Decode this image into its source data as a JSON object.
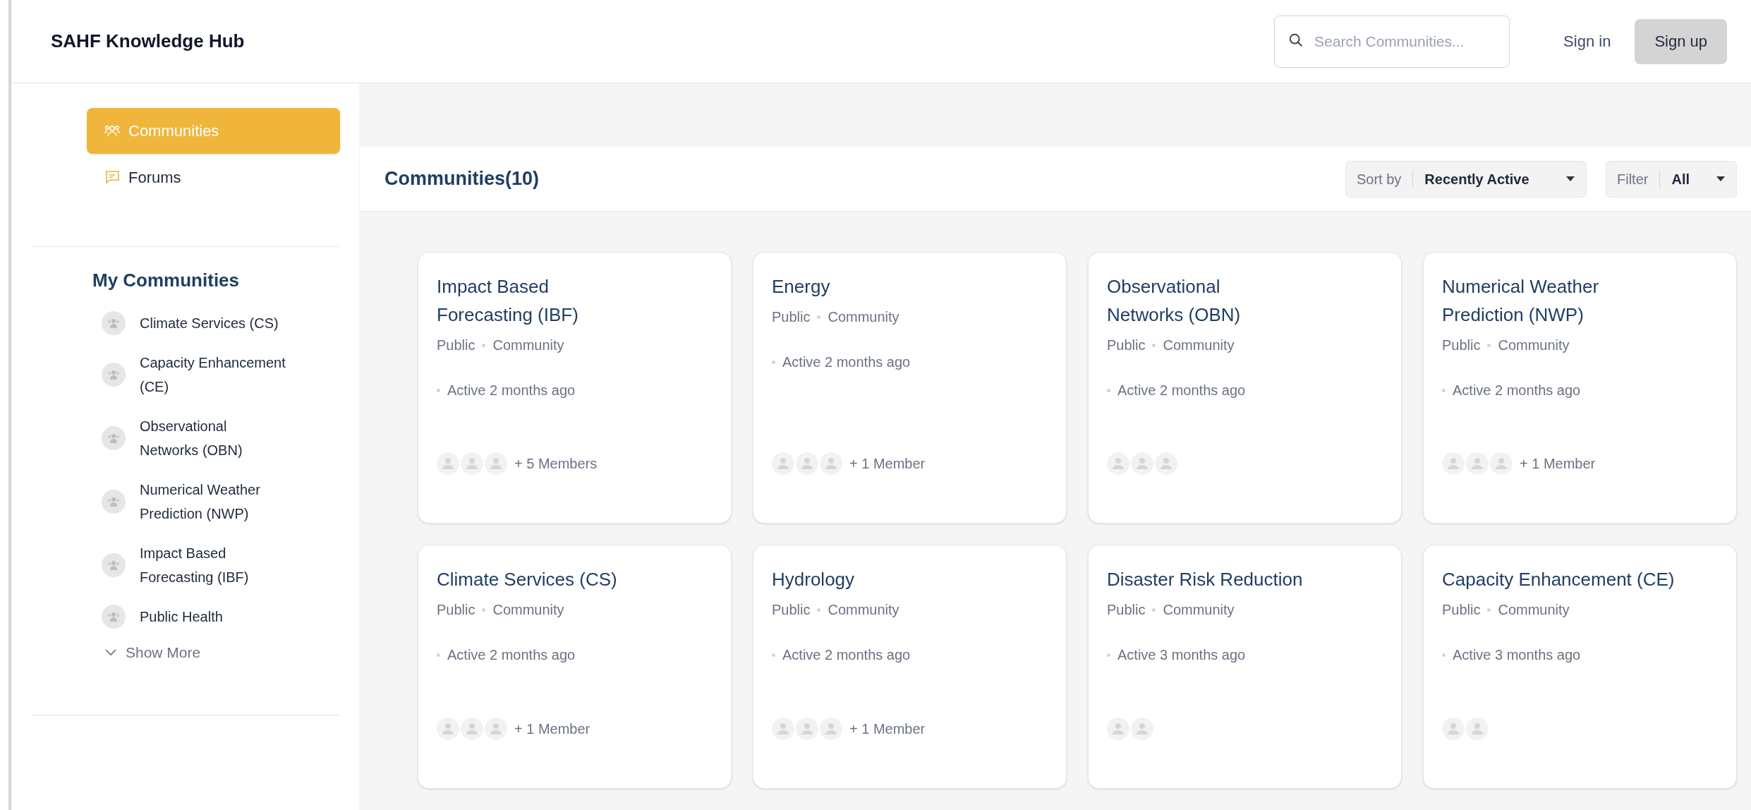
{
  "header": {
    "title": "SAHF Knowledge Hub",
    "search": {
      "placeholder": "Search Communities..."
    },
    "sign_in": "Sign in",
    "sign_up": "Sign up"
  },
  "sidebar": {
    "nav": [
      {
        "label": "Communities",
        "kind": "communities",
        "selected": true
      },
      {
        "label": "Forums",
        "kind": "forums",
        "selected": false
      }
    ],
    "my_communities": {
      "title": "My Communities",
      "items": [
        "Climate Services (CS)",
        "Capacity Enhancement\n(CE)",
        "Observational\nNetworks (OBN)",
        "Numerical Weather\nPrediction (NWP)",
        "Impact Based\nForecasting (IBF)",
        "Public Health"
      ],
      "show_more": "Show More"
    }
  },
  "main": {
    "title": "Communities(10)",
    "sort": {
      "label": "Sort by",
      "value": "Recently Active"
    },
    "filter": {
      "label": "Filter",
      "value": "All"
    },
    "cards": [
      {
        "title": "Impact Based\nForecasting (IBF)",
        "visibility": "Public",
        "type": "Community",
        "activity": "Active 2 months ago",
        "avatars": [
          {
            "kind": "person"
          },
          {
            "kind": "person"
          },
          {
            "kind": "person"
          }
        ],
        "members": "+ 5 Members"
      },
      {
        "title": "Energy",
        "visibility": "Public",
        "type": "Community",
        "activity": "Active 2 months ago",
        "avatars": [
          {
            "kind": "person"
          },
          {
            "kind": "person"
          },
          {
            "kind": "person"
          }
        ],
        "members": "+ 1 Member"
      },
      {
        "title": "Observational\nNetworks (OBN)",
        "visibility": "Public",
        "type": "Community",
        "activity": "Active 2 months ago",
        "avatars": [
          {
            "kind": "person"
          },
          {
            "kind": "person"
          },
          {
            "kind": "person"
          }
        ]
      },
      {
        "title": "Numerical Weather\nPrediction (NWP)",
        "visibility": "Public",
        "type": "Community",
        "activity": "Active 2 months ago",
        "avatars": [
          {
            "kind": "person"
          },
          {
            "kind": "person"
          },
          {
            "kind": "person"
          }
        ],
        "members": "+ 1 Member"
      },
      {
        "title": "Climate Services (CS)",
        "visibility": "Public",
        "type": "Community",
        "activity": "Active 2 months ago",
        "avatars": [
          {
            "kind": "person"
          },
          {
            "kind": "person"
          },
          {
            "kind": "person"
          }
        ],
        "members": "+ 1 Member"
      },
      {
        "title": "Hydrology",
        "visibility": "Public",
        "type": "Community",
        "activity": "Active 2 months ago",
        "avatars": [
          {
            "kind": "person"
          },
          {
            "kind": "person"
          },
          {
            "kind": "person"
          }
        ],
        "members": "+ 1 Member"
      },
      {
        "title": "Disaster Risk Reduction",
        "visibility": "Public",
        "type": "Community",
        "activity": "Active 3 months ago",
        "avatars": [
          {
            "kind": "person"
          },
          {
            "kind": "person"
          }
        ]
      },
      {
        "title": "Capacity Enhancement (CE)",
        "visibility": "Public",
        "type": "Community",
        "activity": "Active 3 months ago",
        "avatars": [
          {
            "kind": "person"
          },
          {
            "kind": "person"
          }
        ]
      }
    ]
  }
}
